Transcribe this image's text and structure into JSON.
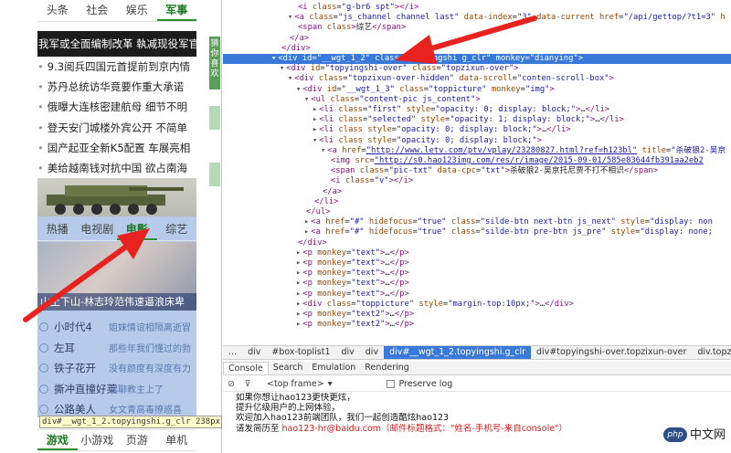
{
  "page": {
    "top_tabs": [
      {
        "label": "头条",
        "active": false
      },
      {
        "label": "社会",
        "active": false
      },
      {
        "label": "娱乐",
        "active": false
      },
      {
        "label": "军事",
        "active": true
      }
    ],
    "banner_headline": "我军或全面编制改革 執减现役军官",
    "news": [
      "9.3阅兵四国元首提前到京内情",
      "苏丹总统访华竟要作重大承诺",
      "俄曝大连核密建航母 细节不明",
      "登天安门城楼外宾公开 不简单",
      "国产起亚全新K5配置 车展亮相",
      "美给越南钱对抗中国 欲占南海"
    ],
    "video_tabs": [
      {
        "label": "热播",
        "active": false
      },
      {
        "label": "电视剧",
        "active": false
      },
      {
        "label": "电影",
        "active": true
      },
      {
        "label": "综艺",
        "active": false
      }
    ],
    "photo_caption": "山上下山-林志玲范伟速逼浪床卑",
    "video_list": [
      {
        "title": "小时代4",
        "desc": "姐妹情谊相隔离逝冒"
      },
      {
        "title": "左耳",
        "desc": "那些年我们懂过的勃"
      },
      {
        "title": "铁子花开",
        "desc": "没有颜度有深度有力"
      },
      {
        "title": "撕冲直撞好莱",
        "desc": "起聊教主上了"
      },
      {
        "title": "公路美人",
        "desc": "女文青高毒撩惑喜"
      }
    ],
    "side_strip": "猜你喜欢",
    "bottom_tabs": [
      "游戏",
      "小游戏",
      "页游",
      "单机"
    ],
    "tooltip": "div#__wgt_1_2.topyingshi.g_clr  238px × 2"
  },
  "devtools": {
    "code_lines": [
      {
        "i": 10,
        "html": "<span class='tg'>&lt;i</span> <span class='an'>class</span>=<span class='av'>\"g-br6 spt\"</span><span class='tg'>&gt;&lt;/i&gt;</span>"
      },
      {
        "i": 9,
        "tri": "▾",
        "html": "<span class='tg'>&lt;a</span> <span class='an'>class</span>=<span class='av'>\"js_channel channel last\"</span> <span class='an'>data-index</span>=<span class='av'>\"3\"</span> <span class='an'>data-current</span> <span class='an'>href</span>=<span class='av'>\"/api/gettop/?t1=3\"</span> <span class='an'>h</span>"
      },
      {
        "i": 10,
        "html": "<span class='tg'>&lt;span</span> <span class='an'>class</span><span class='tg'>&gt;</span><span class='tx'>综艺</span><span class='tg'>&lt;/span&gt;</span>"
      },
      {
        "i": 9,
        "html": "<span class='tg'>&lt;/a&gt;</span>"
      },
      {
        "i": 8,
        "html": "<span class='tg'>&lt;/div&gt;</span>"
      },
      {
        "i": 7,
        "tri": "▾",
        "sel": true,
        "html": "<span class='tg'>&lt;div</span> <span class='an'>id</span>=<span class='av'>\"__wgt_1_2\"</span> <span class='an'>class</span>=<span class='av'>\"topyingshi g_clr\"</span> <span class='an'>monkey</span>=<span class='av'>\"dianying\"</span><span class='tg'>&gt;</span>"
      },
      {
        "i": 8,
        "tri": "▾",
        "html": "<span class='tg'>&lt;div</span> <span class='an'>id</span>=<span class='av'>\"topyingshi-over\"</span> <span class='an'>class</span>=<span class='av'>\"topzixun-over\"</span><span class='tg'>&gt;</span>"
      },
      {
        "i": 9,
        "tri": "▾",
        "html": "<span class='tg'>&lt;div</span> <span class='an'>class</span>=<span class='av'>\"topzixun-over-hidden\"</span> <span class='an'>data-scroll</span>=<span class='av'>\"conten-scroll-box\"</span><span class='tg'>&gt;</span>"
      },
      {
        "i": 10,
        "tri": "▾",
        "html": "<span class='tg'>&lt;div</span> <span class='an'>id</span>=<span class='av'>\"__wgt_1_3\"</span> <span class='an'>class</span>=<span class='av'>\"toppicture\"</span> <span class='an'>monkey</span>=<span class='av'>\"img\"</span><span class='tg'>&gt;</span>"
      },
      {
        "i": 11,
        "tri": "▾",
        "html": "<span class='tg'>&lt;ul</span> <span class='an'>class</span>=<span class='av'>\"content-pic js_content\"</span><span class='tg'>&gt;</span>"
      },
      {
        "i": 12,
        "tri": "▸",
        "html": "<span class='tg'>&lt;li</span> <span class='an'>class</span>=<span class='av'>\"first\"</span> <span class='an'>style</span>=<span class='av'>\"opacity: 0; display: block;\"</span><span class='tg'>&gt;</span>…<span class='tg'>&lt;/li&gt;</span>"
      },
      {
        "i": 12,
        "tri": "▸",
        "html": "<span class='tg'>&lt;li</span> <span class='an'>class</span>=<span class='av'>\"selected\"</span> <span class='an'>style</span>=<span class='av'>\"opacity: 1; display: block;\"</span><span class='tg'>&gt;</span>…<span class='tg'>&lt;/li&gt;</span>"
      },
      {
        "i": 12,
        "tri": "▸",
        "html": "<span class='tg'>&lt;li</span> <span class='an'>class</span> <span class='an'>style</span>=<span class='av'>\"opacity: 0; display: block;\"</span><span class='tg'>&gt;</span>…<span class='tg'>&lt;/li&gt;</span>"
      },
      {
        "i": 12,
        "tri": "▾",
        "html": "<span class='tg'>&lt;li</span> <span class='an'>class</span> <span class='an'>style</span>=<span class='av'>\"opacity: 0; display: block;\"</span><span class='tg'>&gt;</span>"
      },
      {
        "i": 13,
        "tri": "▾",
        "html": "<span class='tg'>&lt;a</span> <span class='an'>href</span>=<span class='av lk'>\"http://www.letv.com/ptv/vplay/23280827.html?ref=h123bl\"</span> <span class='an'>title</span>=<span class='av'>\"杀破狼2-吴京</span>"
      },
      {
        "i": 14,
        "html": "<span class='tg'>&lt;img</span> <span class='an'>src</span>=<span class='av lk'>\"http://s0.hao123img.com/res/r/image/2015-09-01/585e83644fb391aa2eb2</span>"
      },
      {
        "i": 14,
        "html": "<span class='tg'>&lt;span</span> <span class='an'>class</span>=<span class='av'>\"pic-txt\"</span> <span class='an'>data-cpc</span>=<span class='av'>\"txt\"</span><span class='tg'>&gt;</span><span class='tx'>杀破狼2-吴京托尼贾不打不相识</span><span class='tg'>&lt;/span&gt;</span>"
      },
      {
        "i": 14,
        "html": "<span class='tg'>&lt;i</span> <span class='an'>class</span>=<span class='av'>\"v\"</span><span class='tg'>&gt;&lt;/i&gt;</span>"
      },
      {
        "i": 13,
        "html": "<span class='tg'>&lt;/a&gt;</span>"
      },
      {
        "i": 12,
        "html": "<span class='tg'>&lt;/li&gt;</span>"
      },
      {
        "i": 11,
        "html": "<span class='tg'>&lt;/ul&gt;</span>"
      },
      {
        "i": 11,
        "tri": "▸",
        "html": "<span class='tg'>&lt;a</span> <span class='an'>href</span>=<span class='av'>\"#\"</span> <span class='an'>hidefocus</span>=<span class='av'>\"true\"</span> <span class='an'>class</span>=<span class='av'>\"silde-btn next-btn js_next\"</span> <span class='an'>style</span>=<span class='av'>\"display: non</span>"
      },
      {
        "i": 11,
        "tri": "▸",
        "html": "<span class='tg'>&lt;a</span> <span class='an'>href</span>=<span class='av'>\"#\"</span> <span class='an'>hidefocus</span>=<span class='av'>\"true\"</span> <span class='an'>class</span>=<span class='av'>\"silde-btn pre-btn js_pre\"</span> <span class='an'>style</span>=<span class='av'>\"display: none;</span>"
      },
      {
        "i": 10,
        "html": "<span class='tg'>&lt;/div&gt;</span>"
      },
      {
        "i": 10,
        "tri": "▸",
        "html": "<span class='tg'>&lt;p</span> <span class='an'>monkey</span>=<span class='av'>\"text\"</span><span class='tg'>&gt;</span>…<span class='tg'>&lt;/p&gt;</span>"
      },
      {
        "i": 10,
        "tri": "▸",
        "html": "<span class='tg'>&lt;p</span> <span class='an'>monkey</span>=<span class='av'>\"text\"</span><span class='tg'>&gt;</span>…<span class='tg'>&lt;/p&gt;</span>"
      },
      {
        "i": 10,
        "tri": "▸",
        "html": "<span class='tg'>&lt;p</span> <span class='an'>monkey</span>=<span class='av'>\"text\"</span><span class='tg'>&gt;</span>…<span class='tg'>&lt;/p&gt;</span>"
      },
      {
        "i": 10,
        "tri": "▸",
        "html": "<span class='tg'>&lt;p</span> <span class='an'>monkey</span>=<span class='av'>\"text\"</span><span class='tg'>&gt;</span>…<span class='tg'>&lt;/p&gt;</span>"
      },
      {
        "i": 10,
        "tri": "▸",
        "html": "<span class='tg'>&lt;p</span> <span class='an'>monkey</span>=<span class='av'>\"text\"</span><span class='tg'>&gt;</span>…<span class='tg'>&lt;/p&gt;</span>"
      },
      {
        "i": 10,
        "tri": "▸",
        "html": "<span class='tg'>&lt;div</span> <span class='an'>class</span>=<span class='av'>\"toppicture\"</span> <span class='an'>style</span>=<span class='av'>\"margin-top:10px;\"</span><span class='tg'>&gt;</span>…<span class='tg'>&lt;/div&gt;</span>"
      },
      {
        "i": 10,
        "tri": "▸",
        "html": "<span class='tg'>&lt;p</span> <span class='an'>monkey</span>=<span class='av'>\"text2\"</span><span class='tg'>&gt;</span>…<span class='tg'>&lt;/p&gt;</span>"
      },
      {
        "i": 10,
        "tri": "▸",
        "html": "<span class='tg'>&lt;p</span> <span class='an'>monkey</span>=<span class='av'>\"text2\"</span><span class='tg'>&gt;</span>…<span class='tg'>&lt;/p&gt;</span>"
      }
    ],
    "breadcrumbs": [
      {
        "label": "...",
        "active": false
      },
      {
        "label": "div",
        "active": false
      },
      {
        "label": "#box-toplist1",
        "active": false
      },
      {
        "label": "div",
        "active": false
      },
      {
        "label": "div",
        "active": false
      },
      {
        "label": "div#__wgt_1_2.topyingshi.g_clr",
        "active": true
      },
      {
        "label": "div#topyingshi-over.topzixun-over",
        "active": false
      },
      {
        "label": "div.topzixun-over-hidden",
        "active": false
      }
    ],
    "drawer_tabs": [
      {
        "label": "Console",
        "active": true
      },
      {
        "label": "Search",
        "active": false
      },
      {
        "label": "Emulation",
        "active": false
      },
      {
        "label": "Rendering",
        "active": false
      }
    ],
    "frame_select": "<top frame>",
    "preserve_log_label": "Preserve log",
    "console_lines": [
      {
        "text": "如果你想让hao123更快更炫，",
        "red": ""
      },
      {
        "text": "提升亿级用户的上网体验，",
        "red": ""
      },
      {
        "text": "欢迎加入hao123前端团队，我们一起创造酷炫hao123",
        "red": ""
      },
      {
        "text": "请发简历至 ",
        "red": "hao123-hr@baidu.com（邮件标题格式：\"姓名-手机号-来自console\"）"
      }
    ]
  },
  "watermark": {
    "badge": "php",
    "text": "中文网"
  },
  "colors": {
    "selection": "#3879d9",
    "arrow": "#e8231f",
    "highlight": "#7aa0d7",
    "active_tab": "#2e8b2e"
  }
}
